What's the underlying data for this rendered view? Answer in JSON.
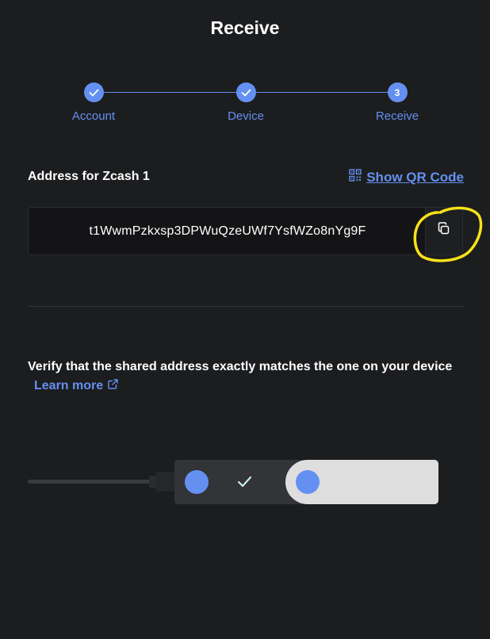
{
  "header": {
    "title": "Receive"
  },
  "stepper": {
    "steps": [
      {
        "label": "Account",
        "state": "done"
      },
      {
        "label": "Device",
        "state": "done"
      },
      {
        "label": "Receive",
        "state": "current",
        "number": "3"
      }
    ]
  },
  "address": {
    "label": "Address for Zcash 1",
    "show_qr_label": "Show QR Code",
    "value": "t1WwmPzkxsp3DPWuQzeUWf7YsfWZo8nYg9F"
  },
  "verify": {
    "text": "Verify that the shared address exactly matches the one on your device",
    "learn_more": "Learn more"
  },
  "colors": {
    "background": "#1c1d1f",
    "accent": "#6490f1",
    "highlight": "#f5e21a"
  },
  "icons": [
    "check-icon",
    "qr-code-icon",
    "copy-icon",
    "external-link-icon"
  ]
}
